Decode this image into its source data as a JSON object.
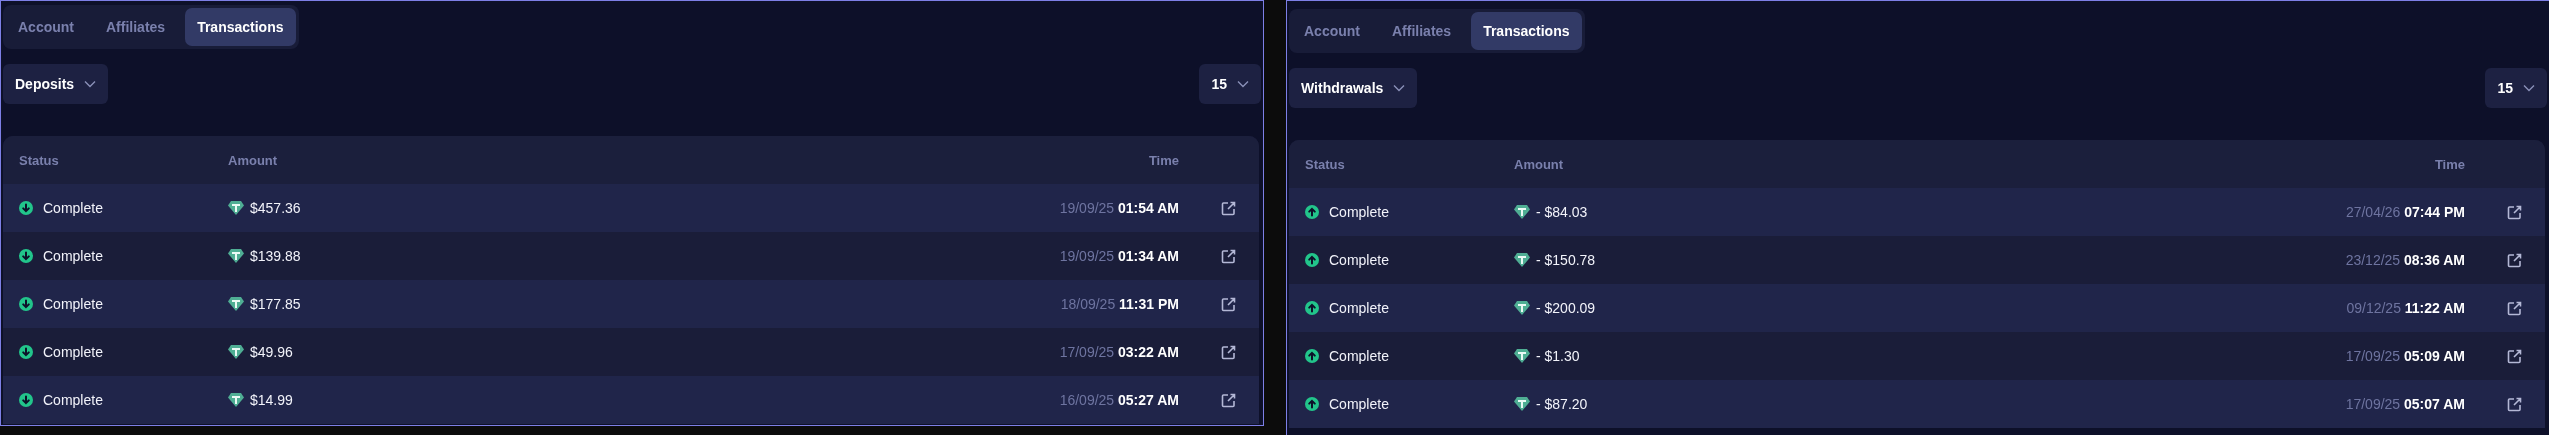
{
  "panels": [
    {
      "tabs": [
        {
          "label": "Account",
          "selected": false
        },
        {
          "label": "Affiliates",
          "selected": false
        },
        {
          "label": "Transactions",
          "selected": true
        }
      ],
      "filter": "Deposits",
      "page_size": "15",
      "table": {
        "columns": [
          "Status",
          "Amount",
          "Time"
        ],
        "rows": [
          {
            "kind": "deposit",
            "status": "Complete",
            "amount": "$457.36",
            "time": "19/09/25 **01:54 AM**"
          },
          {
            "kind": "deposit",
            "status": "Complete",
            "amount": "$139.88",
            "time": "19/09/25 **01:34 AM**"
          },
          {
            "kind": "deposit",
            "status": "Complete",
            "amount": "$177.85",
            "time": "18/09/25 **11:31 PM**"
          },
          {
            "kind": "deposit",
            "status": "Complete",
            "amount": "$49.96",
            "time": "17/09/25 **03:22 AM**"
          },
          {
            "kind": "deposit",
            "status": "Complete",
            "amount": "$14.99",
            "time": "16/09/25 **05:27 AM**"
          }
        ]
      }
    },
    {
      "tabs": [
        {
          "label": "Account",
          "selected": false
        },
        {
          "label": "Affiliates",
          "selected": false
        },
        {
          "label": "Transactions",
          "selected": true
        }
      ],
      "filter": "Withdrawals",
      "page_size": "15",
      "table": {
        "columns": [
          "Status",
          "Amount",
          "Time"
        ],
        "rows": [
          {
            "kind": "withdrawal",
            "status": "Complete",
            "amount": "- $84.03",
            "time": "27/04/26 **07:44 PM**"
          },
          {
            "kind": "withdrawal",
            "status": "Complete",
            "amount": "- $150.78",
            "time": "23/12/25 **08:36 AM**"
          },
          {
            "kind": "withdrawal",
            "status": "Complete",
            "amount": "- $200.09",
            "time": "09/12/25 **11:22 AM**"
          },
          {
            "kind": "withdrawal",
            "status": "Complete",
            "amount": "- $1.30",
            "time": "17/09/25 **05:09 AM**"
          },
          {
            "kind": "withdrawal",
            "status": "Complete",
            "amount": "- $87.20",
            "time": "17/09/25 **05:07 AM**"
          }
        ]
      }
    }
  ]
}
